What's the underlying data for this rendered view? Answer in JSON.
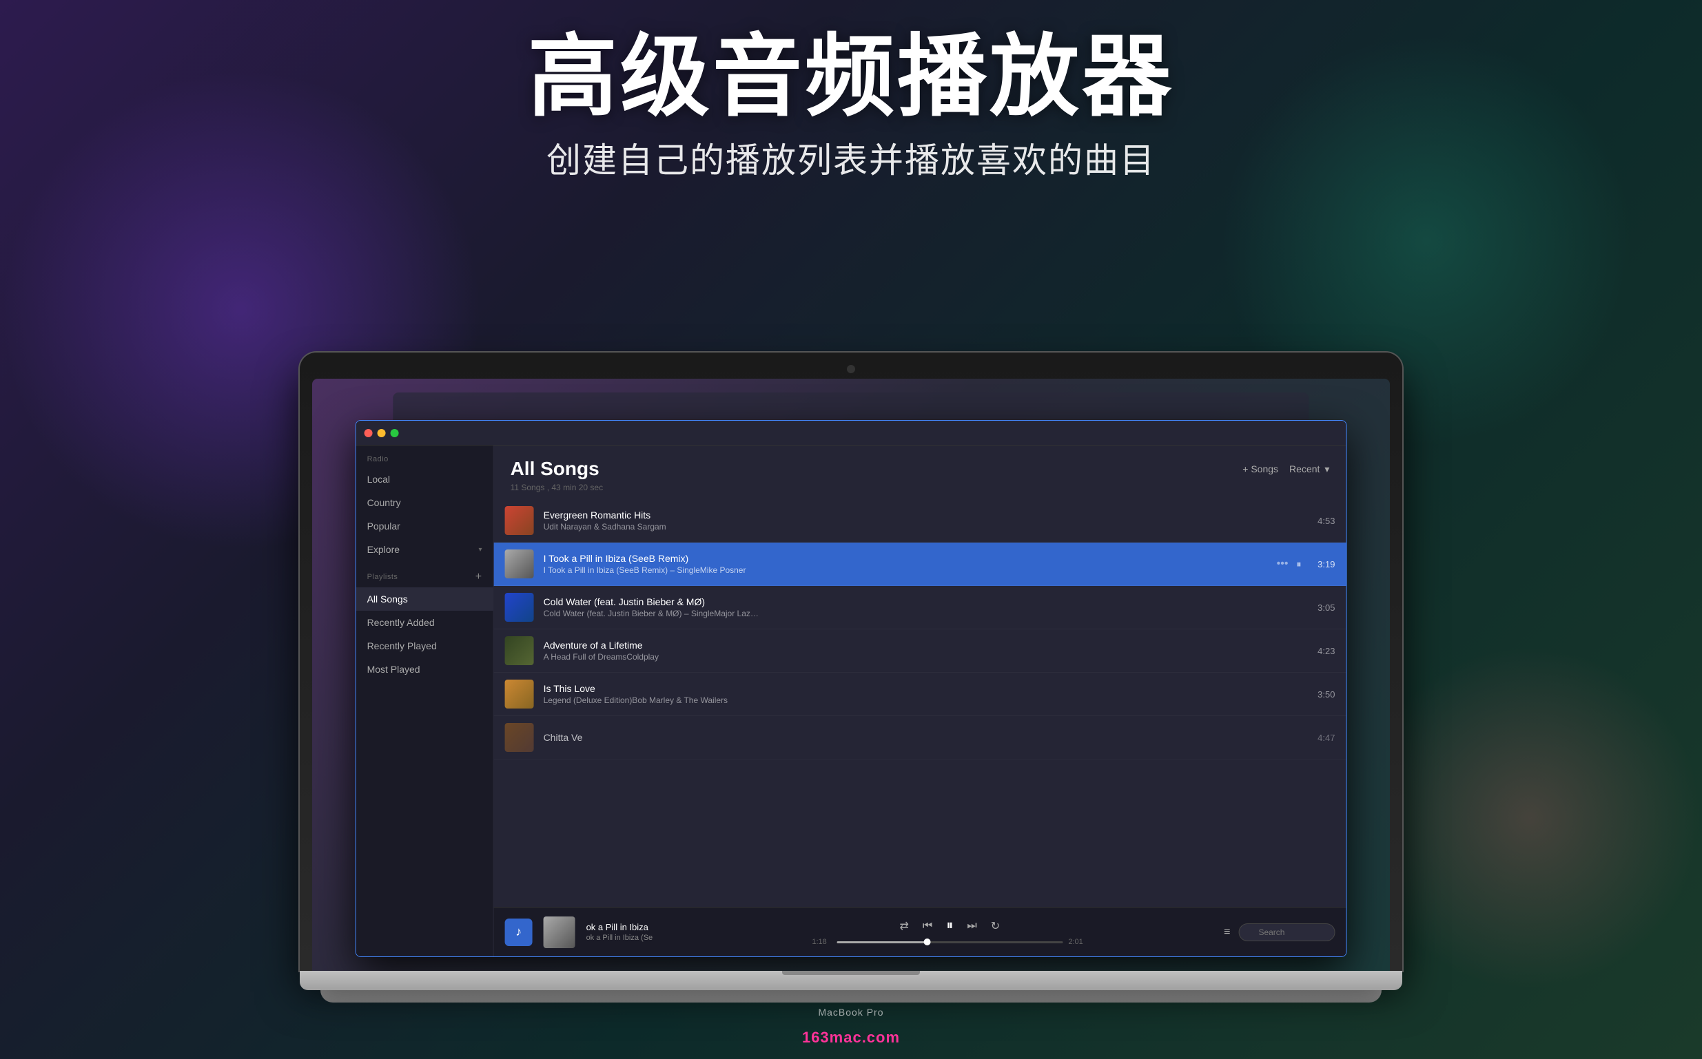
{
  "page": {
    "bg_title": "高级音频播放器",
    "bg_subtitle": "创建自己的播放列表并播放喜欢的曲目",
    "watermark": "163mac.com"
  },
  "macbook": {
    "label": "MacBook Pro"
  },
  "app": {
    "title_bar": {
      "title": ""
    },
    "sidebar": {
      "radio_label": "Radio",
      "items_radio": [
        {
          "label": "Local",
          "active": false
        },
        {
          "label": "Country",
          "active": false
        },
        {
          "label": "Popular",
          "active": false
        },
        {
          "label": "Explore",
          "active": false,
          "has_chevron": true
        }
      ],
      "playlists_label": "Playlists",
      "items_playlists": [
        {
          "label": "All Songs",
          "active": true
        },
        {
          "label": "Recently Added",
          "active": false
        },
        {
          "label": "Recently Played",
          "active": false
        },
        {
          "label": "Most Played",
          "active": false
        }
      ]
    },
    "main": {
      "title": "All Songs",
      "songs_count": "11 Songs , 43 min 20 sec",
      "add_songs_label": "+ Songs",
      "recent_label": "Recent",
      "songs": [
        {
          "id": 1,
          "title": "Evergreen Romantic Hits",
          "subtitle": "Udit Narayan & Sadhana Sargam",
          "duration": "4:53",
          "playing": false,
          "artwork": "1"
        },
        {
          "id": 2,
          "title": "I Took a Pill in Ibiza (SeeB Remix)",
          "subtitle": "I Took a Pill in Ibiza (SeeB Remix) – SingleMike Posner",
          "duration": "3:19",
          "playing": true,
          "artwork": "2"
        },
        {
          "id": 3,
          "title": "Cold Water (feat. Justin Bieber & MØ)",
          "subtitle": "Cold Water (feat. Justin Bieber & MØ) – SingleMajor Laz…",
          "duration": "3:05",
          "playing": false,
          "artwork": "3"
        },
        {
          "id": 4,
          "title": "Adventure of a Lifetime",
          "subtitle": "A Head Full of DreamsColdplay",
          "duration": "4:23",
          "playing": false,
          "artwork": "4"
        },
        {
          "id": 5,
          "title": "Is This Love",
          "subtitle": "Legend (Deluxe Edition)Bob Marley & The Wailers",
          "duration": "3:50",
          "playing": false,
          "artwork": "5"
        },
        {
          "id": 6,
          "title": "Chitta Ve",
          "subtitle": "",
          "duration": "4:47",
          "playing": false,
          "artwork": "6"
        }
      ]
    },
    "player": {
      "current_title": "ok a Pill in Ibiza",
      "current_subtitle": "ok a Pill in Ibiza (Se",
      "time_elapsed": "1:18",
      "time_total": "2:01",
      "progress_percent": 40,
      "search_placeholder": "Search"
    }
  }
}
